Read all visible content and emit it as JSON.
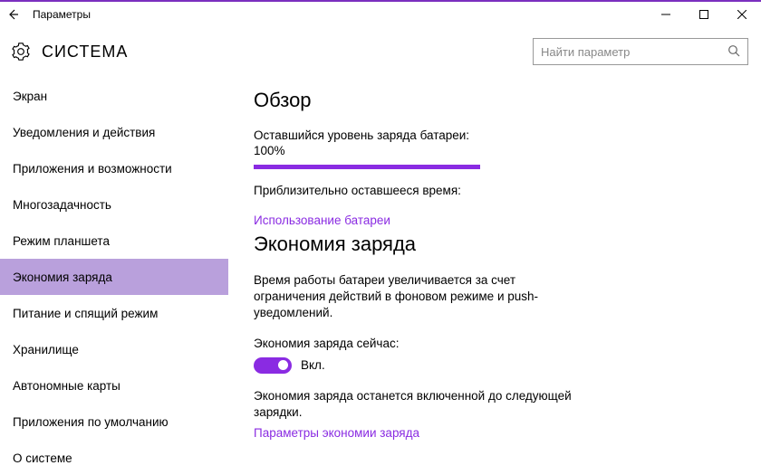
{
  "window": {
    "title": "Параметры"
  },
  "header": {
    "section_title": "СИСТЕМА",
    "search_placeholder": "Найти параметр"
  },
  "sidebar": {
    "items": [
      {
        "label": "Экран"
      },
      {
        "label": "Уведомления и действия"
      },
      {
        "label": "Приложения и возможности"
      },
      {
        "label": "Многозадачность"
      },
      {
        "label": "Режим планшета"
      },
      {
        "label": "Экономия заряда"
      },
      {
        "label": "Питание и спящий режим"
      },
      {
        "label": "Хранилище"
      },
      {
        "label": "Автономные карты"
      },
      {
        "label": "Приложения по умолчанию"
      },
      {
        "label": "О системе"
      }
    ],
    "selected_index": 5
  },
  "content": {
    "overview_heading": "Обзор",
    "remaining_label": "Оставшийся уровень заряда батареи:",
    "remaining_value": "100%",
    "progress_percent": 100,
    "time_label": "Приблизительно оставшееся время:",
    "usage_link": "Использование батареи",
    "saver_heading": "Экономия заряда",
    "saver_desc": "Время работы батареи увеличивается за счет ограничения действий в фоновом режиме и push-уведомлений.",
    "saver_now_label": "Экономия заряда сейчас:",
    "toggle_on": true,
    "toggle_label": "Вкл.",
    "saver_note": "Экономия заряда останется включенной до следующей зарядки.",
    "saver_settings_link": "Параметры экономии заряда"
  },
  "colors": {
    "accent": "#8a2be2",
    "selected_bg": "#b9a0dc"
  }
}
